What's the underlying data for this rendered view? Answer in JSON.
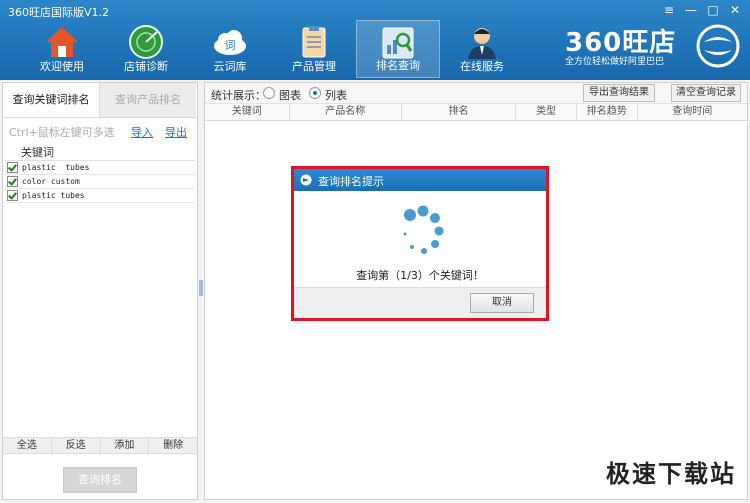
{
  "app": {
    "title": "360旺店国际版V1.2"
  },
  "window_controls": {
    "menu": "≡",
    "minimize": "—",
    "maximize": "□",
    "close": "✕"
  },
  "toolbar": [
    {
      "label": "欢迎使用",
      "icon": "home-icon"
    },
    {
      "label": "店铺诊断",
      "icon": "radar-icon"
    },
    {
      "label": "云词库",
      "icon": "cloud-icon"
    },
    {
      "label": "产品管理",
      "icon": "clipboard-icon"
    },
    {
      "label": "排名查询",
      "icon": "magnifier-chart-icon",
      "active": true
    },
    {
      "label": "在线服务",
      "icon": "support-agent-icon"
    }
  ],
  "brand": {
    "name": "360旺店",
    "slogan": "全方位轻松做好阿里巴巴"
  },
  "left": {
    "tabs": [
      "查询关键词排名",
      "查询产品排名"
    ],
    "hint": "Ctrl+鼠标左键可多选",
    "import": "导入",
    "export": "导出",
    "keyword_header": "关键词",
    "keywords": [
      "plastic  tubes",
      "color custom",
      "plastic tubes"
    ],
    "actions": [
      "全选",
      "反选",
      "添加",
      "删除"
    ],
    "query_button": "查询排名"
  },
  "right": {
    "stats_label": "统计展示：",
    "radio_chart": "图表",
    "radio_list": "列表",
    "export_results": "导出查询结果",
    "clear_records": "清空查询记录",
    "columns": [
      "关键词",
      "产品名称",
      "排名",
      "类型",
      "排名趋势",
      "查询时间"
    ]
  },
  "dialog": {
    "title": "查询排名提示",
    "message": "查询第（1/3）个关键词！",
    "cancel": "取消"
  },
  "watermark": "极速下载站"
}
